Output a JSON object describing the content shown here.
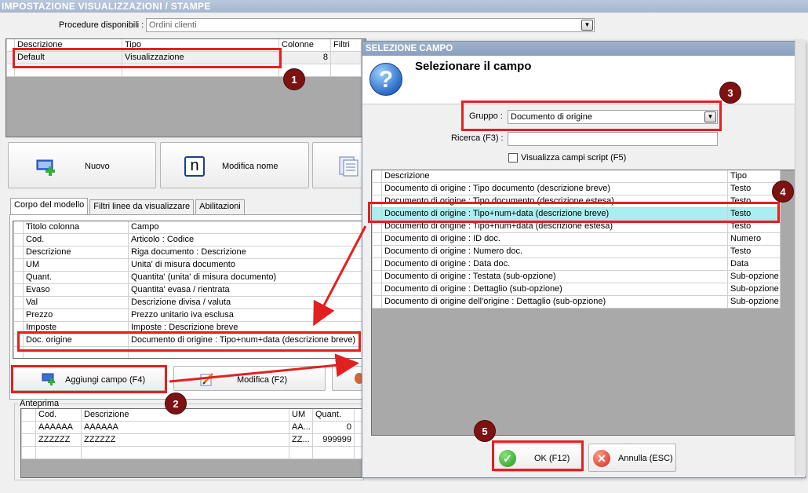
{
  "window": {
    "title": "IMPOSTAZIONE VISUALIZZAZIONI / STAMPE"
  },
  "procedure": {
    "label": "Procedure disponibili :",
    "value": "Ordini clienti"
  },
  "models": {
    "columns": [
      "Descrizione",
      "Tipo",
      "Colonne",
      "Filtri"
    ],
    "rows": [
      {
        "descrizione": "Default",
        "tipo": "Visualizzazione",
        "colonne": "8",
        "filtri": ""
      }
    ]
  },
  "toolbar": {
    "nuovo": "Nuovo",
    "modifica_nome": "Modifica nome",
    "n_glyph": "n"
  },
  "tabs": [
    "Corpo del modello",
    "Filtri linee da visualizzare",
    "Abilitazioni"
  ],
  "fields": {
    "columns": [
      "Titolo colonna",
      "Campo"
    ],
    "rows": [
      {
        "titolo": "Cod.",
        "campo": "Articolo : Codice"
      },
      {
        "titolo": "Descrizione",
        "campo": "Riga documento : Descrizione"
      },
      {
        "titolo": "UM",
        "campo": "Unita' di misura documento"
      },
      {
        "titolo": "Quant.",
        "campo": "Quantita' (unita' di misura documento)"
      },
      {
        "titolo": "Evaso",
        "campo": "Quantita' evasa / rientrata"
      },
      {
        "titolo": "Val",
        "campo": "Descrizione divisa / valuta"
      },
      {
        "titolo": "Prezzo",
        "campo": "Prezzo unitario iva esclusa"
      },
      {
        "titolo": "Imposte",
        "campo": "Imposte : Descrizione breve"
      },
      {
        "titolo": "Doc. origine",
        "campo": "Documento di origine : Tipo+num+data (descrizione breve)"
      }
    ]
  },
  "actions": {
    "aggiungi": "Aggiungi campo (F4)",
    "modifica": "Modifica (F2)"
  },
  "preview": {
    "legend": "Anteprima",
    "columns": [
      "Cod.",
      "Descrizione",
      "UM",
      "Quant."
    ],
    "rows": [
      {
        "cod": "AAAAAA",
        "descrizione": "AAAAAA",
        "um": "AA...",
        "quant": "0"
      },
      {
        "cod": "ZZZZZZ",
        "descrizione": "ZZZZZZ",
        "um": "ZZ...",
        "quant": "999999"
      }
    ]
  },
  "dialog": {
    "title": "SELEZIONE CAMPO",
    "close": "×",
    "heading": "Selezionare il campo",
    "icon_glyph": "?",
    "gruppo_label": "Gruppo :",
    "gruppo_value": "Documento di origine",
    "ricerca_label": "Ricerca (F3) :",
    "ricerca_value": "",
    "checkbox_label": "Visualizza campi script (F5)",
    "columns": [
      "Descrizione",
      "Tipo"
    ],
    "rows": [
      {
        "descrizione": "Documento di origine : Tipo documento (descrizione breve)",
        "tipo": "Testo"
      },
      {
        "descrizione": "Documento di origine : Tipo documento (descrizione estesa)",
        "tipo": "Testo"
      },
      {
        "descrizione": "Documento di origine : Tipo+num+data (descrizione breve)",
        "tipo": "Testo"
      },
      {
        "descrizione": "Documento di origine : Tipo+num+data (descrizione estesa)",
        "tipo": "Testo"
      },
      {
        "descrizione": "Documento di origine : ID doc.",
        "tipo": "Numero"
      },
      {
        "descrizione": "Documento di origine : Numero doc.",
        "tipo": "Testo"
      },
      {
        "descrizione": "Documento di origine : Data doc.",
        "tipo": "Data"
      },
      {
        "descrizione": "Documento di origine : Testata (sub-opzione)",
        "tipo": "Sub-opzione"
      },
      {
        "descrizione": "Documento di origine : Dettaglio (sub-opzione)",
        "tipo": "Sub-opzione"
      },
      {
        "descrizione": "Documento di origine dell'origine : Dettaglio (sub-opzione)",
        "tipo": "Sub-opzione"
      }
    ],
    "ok": "OK (F12)",
    "annulla": "Annulla (ESC)"
  },
  "badges": [
    "1",
    "2",
    "3",
    "4",
    "5"
  ],
  "colors": {
    "annotation_red": "#e32020",
    "badge": "#7c1212",
    "selected_row": "#a9eef0"
  }
}
